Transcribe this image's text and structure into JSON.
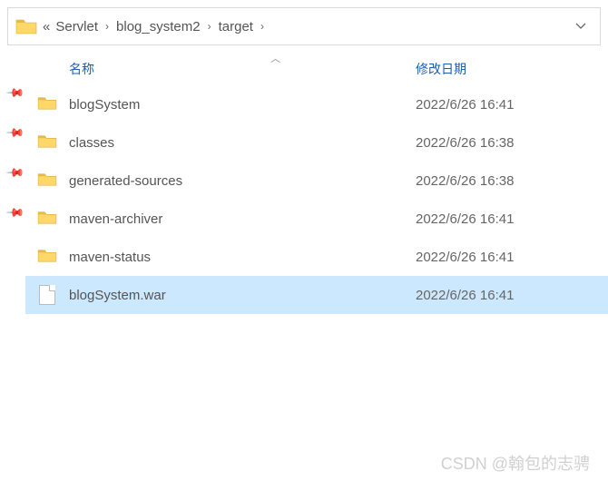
{
  "breadcrumb": {
    "prefix": "«",
    "items": [
      "Servlet",
      "blog_system2",
      "target"
    ]
  },
  "headers": {
    "name": "名称",
    "modified": "修改日期"
  },
  "rows": [
    {
      "type": "folder",
      "name": "blogSystem",
      "date": "2022/6/26 16:41",
      "pinned": true,
      "selected": false
    },
    {
      "type": "folder",
      "name": "classes",
      "date": "2022/6/26 16:38",
      "pinned": true,
      "selected": false
    },
    {
      "type": "folder",
      "name": "generated-sources",
      "date": "2022/6/26 16:38",
      "pinned": true,
      "selected": false
    },
    {
      "type": "folder",
      "name": "maven-archiver",
      "date": "2022/6/26 16:41",
      "pinned": true,
      "selected": false
    },
    {
      "type": "folder",
      "name": "maven-status",
      "date": "2022/6/26 16:41",
      "pinned": false,
      "selected": false
    },
    {
      "type": "file",
      "name": "blogSystem.war",
      "date": "2022/6/26 16:41",
      "pinned": false,
      "selected": true
    }
  ],
  "watermark": "CSDN @翰包的志骋"
}
